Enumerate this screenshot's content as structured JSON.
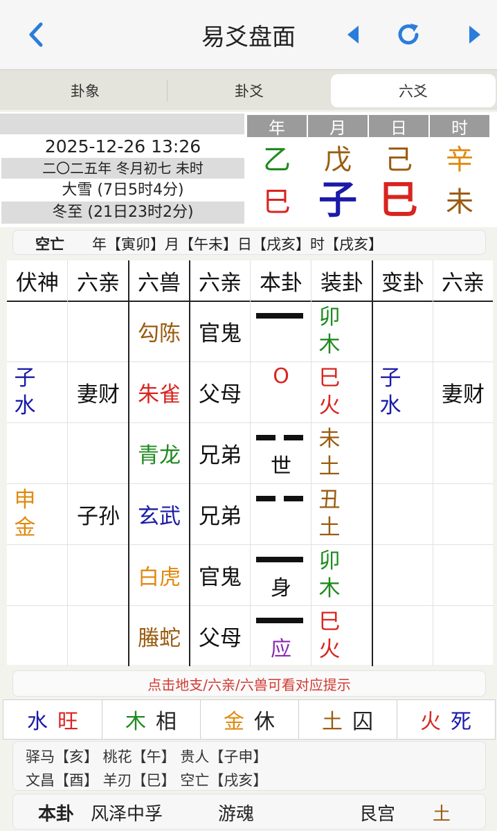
{
  "nav": {
    "title": "易爻盘面",
    "back_icon": "chevron-left-icon",
    "prev_icon": "triangle-left-icon",
    "refresh_icon": "refresh-icon",
    "next_icon": "triangle-right-icon",
    "accent": "#2a7ddb"
  },
  "tabs": [
    {
      "label": "卦象"
    },
    {
      "label": "卦爻"
    },
    {
      "label": "六爻",
      "active": true
    }
  ],
  "info": {
    "datetime": "2025-12-26 13:26",
    "lunar": "二〇二五年 冬月初七 未时",
    "term1": "大雪 (7日5时4分)",
    "term2": "冬至 (21日23时2分)"
  },
  "pillars": [
    {
      "label": "年",
      "stem": "乙",
      "stem_color": "#1f8a1f",
      "branch": "巳",
      "branch_color": "#d9241f",
      "branch_size": "normal"
    },
    {
      "label": "月",
      "stem": "戊",
      "stem_color": "#9a5c10",
      "branch": "子",
      "branch_color": "#1a1aa8",
      "branch_size": "large"
    },
    {
      "label": "日",
      "stem": "己",
      "stem_color": "#9a5c10",
      "branch": "巳",
      "branch_color": "#d9241f",
      "branch_size": "large"
    },
    {
      "label": "时",
      "stem": "辛",
      "stem_color": "#e08a10",
      "branch": "未",
      "branch_color": "#9a5c10",
      "branch_size": "normal"
    }
  ],
  "kongwang": {
    "label": "空亡",
    "text": "年【寅卯】月【午未】日【戌亥】时【戌亥】"
  },
  "table": {
    "headers": [
      "伏神",
      "六亲",
      "六兽",
      "六亲",
      "本卦",
      "装卦",
      "变卦",
      "六亲"
    ],
    "rows": [
      {
        "fushen": "",
        "fushen_el": "",
        "fushen_color": "",
        "fu_relation": "",
        "beast": "勾陈",
        "beast_color": "#9a5c10",
        "relation": "官鬼",
        "line": "yang",
        "mark": "",
        "mark_color": "",
        "zhi": "卯",
        "wx": "木",
        "zhi_color": "#1f8a1f",
        "bian_zhi": "",
        "bian_wx": "",
        "bian_color": "",
        "bian_relation": ""
      },
      {
        "fushen": "子",
        "fushen_el": "水",
        "fushen_color": "#1a1aa8",
        "fu_relation": "妻财",
        "beast": "朱雀",
        "beast_color": "#d9241f",
        "relation": "父母",
        "line": "moving-yang",
        "mark": "O",
        "mark_color": "#d9241f",
        "zhi": "巳",
        "wx": "火",
        "zhi_color": "#d9241f",
        "bian_zhi": "子",
        "bian_wx": "水",
        "bian_color": "#1a1aa8",
        "bian_relation": "妻财"
      },
      {
        "fushen": "",
        "fushen_el": "",
        "fushen_color": "",
        "fu_relation": "",
        "beast": "青龙",
        "beast_color": "#1f8a1f",
        "relation": "兄弟",
        "line": "yin",
        "mark": "世",
        "mark_color": "#111111",
        "zhi": "未",
        "wx": "土",
        "zhi_color": "#9a5c10",
        "bian_zhi": "",
        "bian_wx": "",
        "bian_color": "",
        "bian_relation": ""
      },
      {
        "fushen": "申",
        "fushen_el": "金",
        "fushen_color": "#e08a10",
        "fu_relation": "子孙",
        "beast": "玄武",
        "beast_color": "#1a1aa8",
        "relation": "兄弟",
        "line": "yin",
        "mark": "",
        "mark_color": "",
        "zhi": "丑",
        "wx": "土",
        "zhi_color": "#9a5c10",
        "bian_zhi": "",
        "bian_wx": "",
        "bian_color": "",
        "bian_relation": ""
      },
      {
        "fushen": "",
        "fushen_el": "",
        "fushen_color": "",
        "fu_relation": "",
        "beast": "白虎",
        "beast_color": "#e08a10",
        "relation": "官鬼",
        "line": "yang",
        "mark": "身",
        "mark_color": "#111111",
        "zhi": "卯",
        "wx": "木",
        "zhi_color": "#1f8a1f",
        "bian_zhi": "",
        "bian_wx": "",
        "bian_color": "",
        "bian_relation": ""
      },
      {
        "fushen": "",
        "fushen_el": "",
        "fushen_color": "",
        "fu_relation": "",
        "beast": "螣蛇",
        "beast_color": "#9a5c10",
        "relation": "父母",
        "line": "yang",
        "mark": "应",
        "mark_color": "#8a2bb0",
        "zhi": "巳",
        "wx": "火",
        "zhi_color": "#d9241f",
        "bian_zhi": "",
        "bian_wx": "",
        "bian_color": "",
        "bian_relation": ""
      }
    ]
  },
  "hint": "点击地支/六亲/六兽可看对应提示",
  "wuxing": [
    {
      "el": "水",
      "el_color": "#1a1aa8",
      "state": "旺",
      "state_color": "#d9241f"
    },
    {
      "el": "木",
      "el_color": "#1f8a1f",
      "state": "相",
      "state_color": "#222222"
    },
    {
      "el": "金",
      "el_color": "#e08a10",
      "state": "休",
      "state_color": "#222222"
    },
    {
      "el": "土",
      "el_color": "#9a5c10",
      "state": "囚",
      "state_color": "#222222"
    },
    {
      "el": "火",
      "el_color": "#d9241f",
      "state": "死",
      "state_color": "#1a1aa8"
    }
  ],
  "shensha": {
    "line1": "驿马【亥】 桃花【午】 贵人【子申】",
    "line2": "文昌【酉】 羊刃【巳】 空亡【戌亥】"
  },
  "bottom": {
    "label": "本卦",
    "name": "风泽中孚",
    "type": "游魂",
    "palace": "艮宫",
    "element": "土",
    "element_color": "#9a5c10"
  }
}
